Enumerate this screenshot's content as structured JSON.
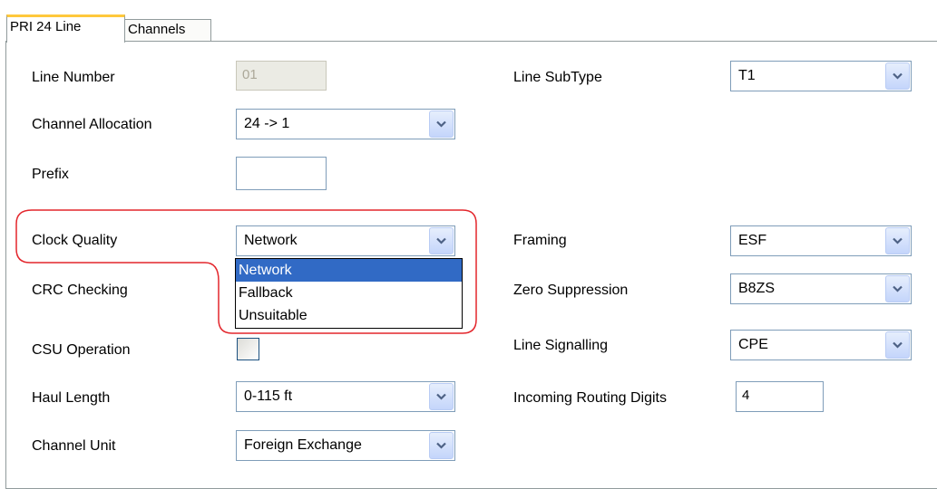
{
  "tabs": [
    "PRI 24 Line",
    "Channels"
  ],
  "fields": {
    "line_number": {
      "label": "Line Number",
      "value": "01"
    },
    "channel_allocation": {
      "label": "Channel Allocation",
      "value": "24 -> 1"
    },
    "prefix": {
      "label": "Prefix",
      "value": ""
    },
    "clock_quality": {
      "label": "Clock Quality",
      "value": "Network",
      "options": [
        "Network",
        "Fallback",
        "Unsuitable"
      ]
    },
    "crc_checking": {
      "label": "CRC Checking"
    },
    "csu_operation": {
      "label": "CSU Operation",
      "checked": false
    },
    "haul_length": {
      "label": "Haul Length",
      "value": "0-115 ft"
    },
    "channel_unit": {
      "label": "Channel Unit",
      "value": "Foreign Exchange"
    },
    "line_subtype": {
      "label": "Line SubType",
      "value": "T1"
    },
    "framing": {
      "label": "Framing",
      "value": "ESF"
    },
    "zero_suppression": {
      "label": "Zero Suppression",
      "value": "B8ZS"
    },
    "line_signalling": {
      "label": "Line Signalling",
      "value": "CPE"
    },
    "incoming_routing_digits": {
      "label": "Incoming Routing Digits",
      "value": "4"
    }
  },
  "highlight_color": "#e3262c"
}
